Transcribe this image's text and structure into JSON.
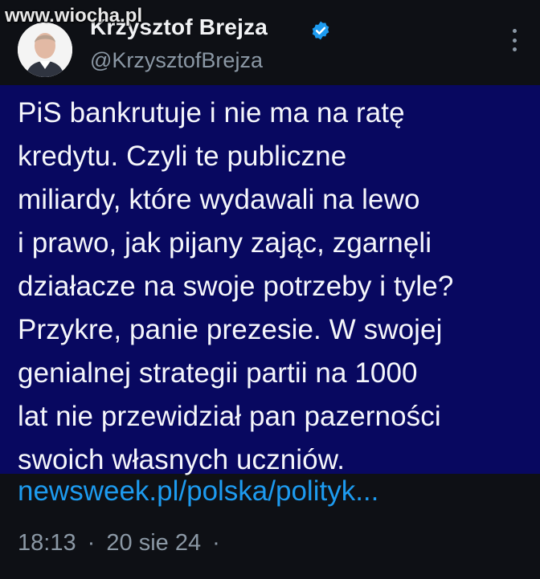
{
  "watermark": "www.wiocha.pl",
  "author": {
    "display_name": "Krzysztof Brejza",
    "handle": "@KrzysztofBrejza",
    "verified": true
  },
  "tweet": {
    "text": "PiS bankrutuje i nie ma na ratę\nkredytu. Czyli te publiczne\nmiliardy, które wydawali na lewo\ni prawo, jak pijany zając, zgarnęli\ndziałacze na swoje potrzeby i tyle?\nPrzykre, panie prezesie. W swojej\ngenialnej strategii partii na 1000\nlat nie przewidział pan pazerności\nswoich własnych uczniów.",
    "link_text": "newsweek.pl/polska/polityk...",
    "time": "18:13",
    "date": "20 sie 24",
    "dot": "·"
  },
  "icons": {
    "verified": "verified-badge-icon",
    "more": "more-options-icon"
  },
  "colors": {
    "background": "#0e1015",
    "tweet_highlight": "#080860",
    "link": "#1d9bf0",
    "muted": "#8b98a5",
    "verified": "#1d9bf0"
  }
}
